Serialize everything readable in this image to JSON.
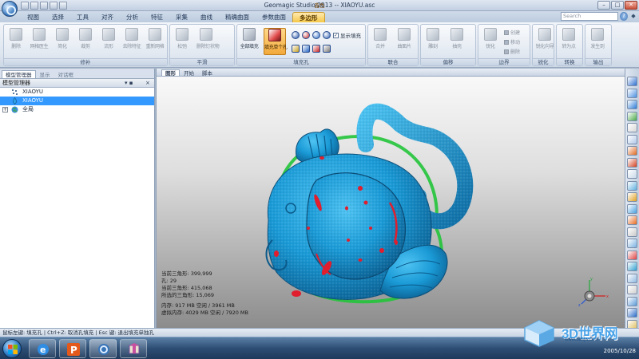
{
  "window": {
    "title": "Geomagic Studio 2013 -- XIAOYU.asc",
    "tag": "鑫色",
    "minimize": "–",
    "maximize": "□",
    "close": "✕"
  },
  "ribbon_tabs": [
    {
      "label": "视图"
    },
    {
      "label": "选择"
    },
    {
      "label": "工具"
    },
    {
      "label": "对齐"
    },
    {
      "label": "分析"
    },
    {
      "label": "特征"
    },
    {
      "label": "采集"
    },
    {
      "label": "曲线"
    },
    {
      "label": "精确曲面"
    },
    {
      "label": "参数曲面"
    },
    {
      "label": "多边形",
      "active": true
    }
  ],
  "search": {
    "placeholder": "Search",
    "help": "?",
    "extra": "◆"
  },
  "ribbon_groups": [
    {
      "label": "修补",
      "buttons": [
        "删除",
        "网格医生",
        "简化",
        "裁剪",
        "流形",
        "去除特征",
        "重新网格"
      ]
    },
    {
      "label": "平滑",
      "buttons": [
        "松弛",
        "删除钉状物"
      ]
    },
    {
      "label": "填充孔",
      "buttons": [
        "全部填充",
        "填充单个孔"
      ],
      "checkbox": "显示填充"
    },
    {
      "label": "联合",
      "buttons": [
        "合并",
        "曲面片"
      ]
    },
    {
      "label": "偏移",
      "buttons": [
        "雕刻",
        "抽壳"
      ]
    },
    {
      "label": "边界",
      "buttons": [
        "锐化"
      ],
      "small_buttons": [
        "创建",
        "移动",
        "删除"
      ]
    },
    {
      "label": "锐化",
      "buttons": [
        "锐化向导"
      ]
    },
    {
      "label": "转换",
      "buttons": [
        "转为点"
      ]
    },
    {
      "label": "输出",
      "buttons": [
        "发生到"
      ]
    }
  ],
  "left_panel": {
    "tabs": [
      "模型管理器",
      "显示",
      "对话框"
    ],
    "header": "模型管理器",
    "pin": "▾ ▪",
    "close": "×",
    "tree": [
      {
        "label": "XIAOYU",
        "icon": "points-icon"
      },
      {
        "label": "XIAOYU",
        "icon": "polygon-icon",
        "selected": true
      },
      {
        "label": "全局",
        "icon": "globe-icon",
        "expand": "+"
      }
    ]
  },
  "viewport": {
    "tabs": [
      {
        "label": "图形",
        "active": true
      },
      {
        "label": "开始"
      },
      {
        "label": "脚本"
      }
    ],
    "stats": [
      "当前三角形: 399,999",
      "孔: 29",
      "当前三角形: 415,068",
      "所选的三角形: 15,069",
      "",
      "内存: 917 MB 空闲 / 3961 MB",
      "虚拟内存: 4029 MB 空闲 / 7920 MB"
    ],
    "axis_labels": {
      "x": "x",
      "y": "y",
      "z": "z"
    }
  },
  "statusbar": {
    "text": "鼠标左键: 填充孔 | Ctrl+Z: 取消孔填充 | Esc 键: 退出填充单独孔"
  },
  "taskbar": {
    "date": "2005/10/28",
    "watermark": "3D世界网",
    "watermark_sub": "www.3dsjw.com"
  },
  "colors": {
    "mesh": "#1a9ad6",
    "hole": "#e01e2e",
    "boundary": "#22c43a",
    "active_tab": "#f5c84a",
    "selection": "#3399ff"
  }
}
